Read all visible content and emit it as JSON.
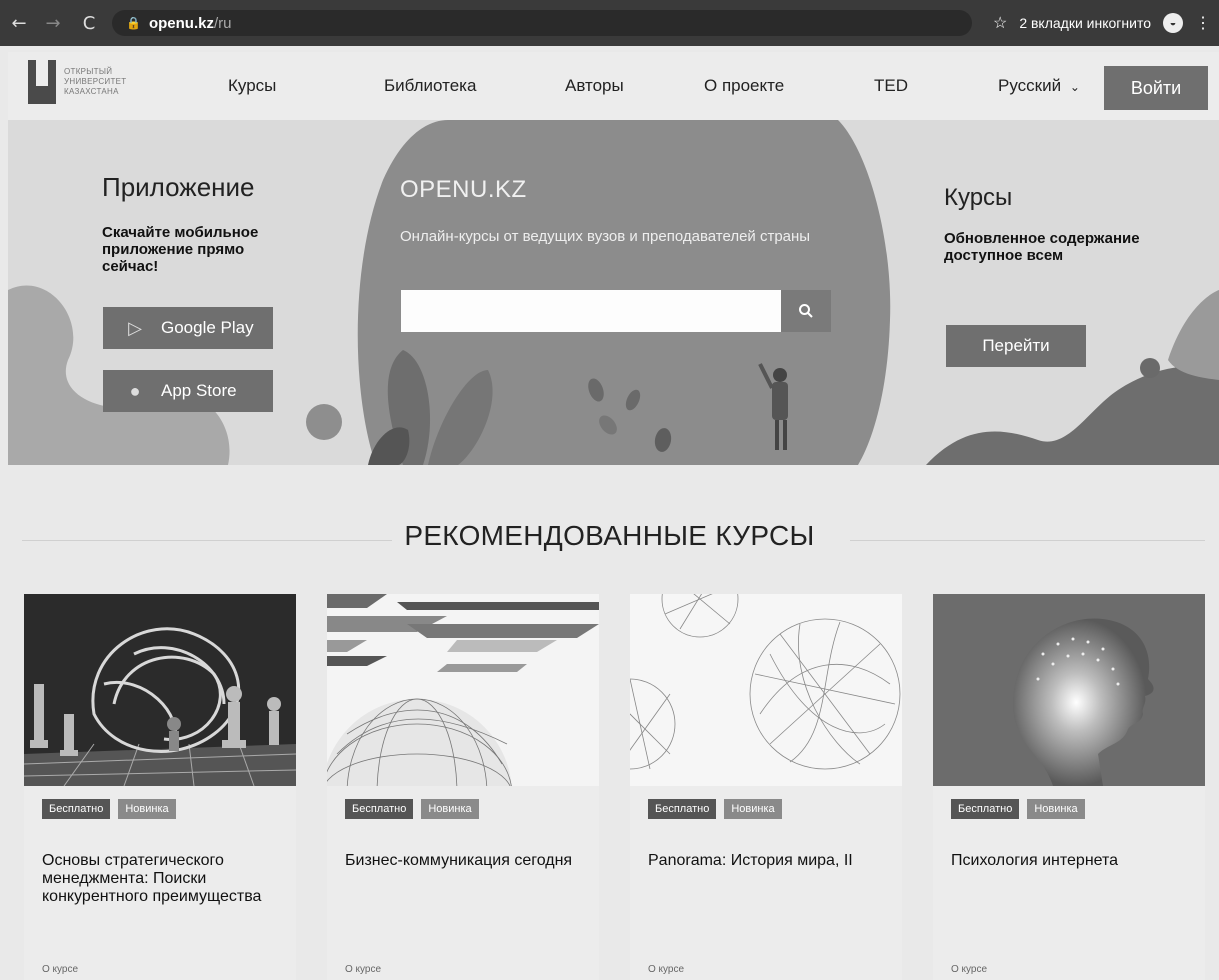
{
  "browser": {
    "url_domain": "openu.kz",
    "url_path": "/ru",
    "incognito_label": "2 вкладки инкогнито",
    "icons": [
      "back-arrow-icon",
      "forward-arrow-icon",
      "reload-icon",
      "lock-icon",
      "star-icon",
      "incognito-icon",
      "more-vert-icon"
    ]
  },
  "header": {
    "logo_lines": [
      "ОТКРЫТЫЙ",
      "УНИВЕРСИТЕТ",
      "КАЗАХСТАНА"
    ],
    "menu": [
      "Курсы",
      "Библиотека",
      "Авторы",
      "О проекте",
      "TED"
    ],
    "language": "Русский",
    "login_label": "Войти"
  },
  "hero": {
    "app": {
      "title": "Приложение",
      "description": "Скачайте мобильное приложение прямо сейчас!",
      "google_play": "Google Play",
      "app_store": "App Store"
    },
    "main": {
      "title": "OPENU.KZ",
      "description": "Онлайн-курсы от ведущих вузов и преподавателей страны",
      "search_value": "",
      "search_placeholder": ""
    },
    "courses": {
      "title": "Курсы",
      "description": "Обновленное содержание доступное всем",
      "button_label": "Перейти"
    }
  },
  "recommended": {
    "title": "РЕКОМЕНДОВАННЫЕ КУРСЫ",
    "cards": [
      {
        "badge_free": "Бесплатно",
        "badge_new": "Новинка",
        "title": "Основы стратегического менеджмента: Поиски конкурентного преимущества",
        "link": "О курсе"
      },
      {
        "badge_free": "Бесплатно",
        "badge_new": "Новинка",
        "title": "Бизнес-коммуникация сегодня",
        "link": "О курсе"
      },
      {
        "badge_free": "Бесплатно",
        "badge_new": "Новинка",
        "title": "Panorama: История мира, II",
        "link": "О курсе"
      },
      {
        "badge_free": "Бесплатно",
        "badge_new": "Новинка",
        "title": "Психология интернета",
        "link": "О курсе"
      }
    ]
  },
  "colors": {
    "button_gray": "#6f6f6f",
    "hero_background": "#dadada",
    "browser_chrome": "#3a3a3a"
  }
}
